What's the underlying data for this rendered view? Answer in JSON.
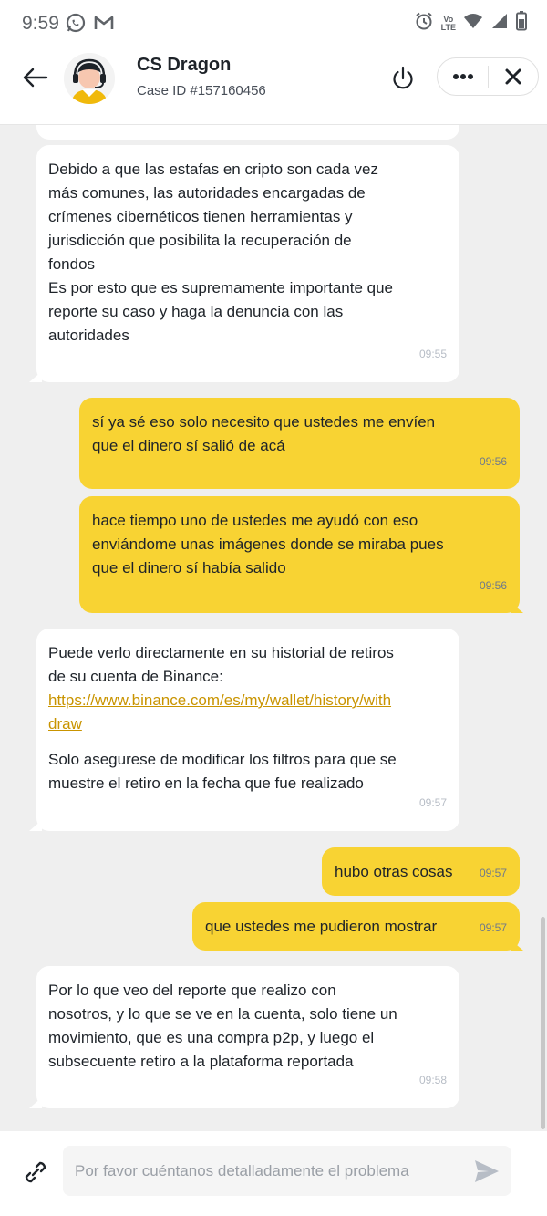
{
  "status_bar": {
    "time": "9:59",
    "lte_top": "Vo",
    "lte_bottom": "LTE"
  },
  "header": {
    "agent_name": "CS Dragon",
    "case_id": "Case ID #157160456"
  },
  "messages": [
    {
      "side": "in",
      "text": "Debido a que las estafas en cripto son cada vez\nmás comunes, las autoridades encargadas de\ncrímenes cibernéticos tienen herramientas y\njurisdicción que posibilita la recuperación de\nfondos\nEs por esto que es supremamente importante que\nreporte su caso y haga la denuncia con las\nautoridades",
      "time": "09:55"
    },
    {
      "side": "out",
      "text": "sí ya sé eso solo necesito que ustedes me envíen\nque el dinero sí salió de acá",
      "time": "09:56"
    },
    {
      "side": "out",
      "text": "hace tiempo uno de ustedes me ayudó con eso\nenviándome unas imágenes donde se miraba pues\nque el dinero sí había salido",
      "time": "09:56"
    },
    {
      "side": "in",
      "text_before_link": "Puede verlo directamente en su historial de retiros\nde su cuenta de Binance:",
      "link": "https://www.binance.com/es/my/wallet/history/with\ndraw",
      "text_after_link": "Solo asegurese de modificar los filtros para que se\nmuestre el retiro en la fecha que fue realizado",
      "time": "09:57"
    },
    {
      "side": "out",
      "text": "hubo otras cosas",
      "time": "09:57"
    },
    {
      "side": "out",
      "text": "que ustedes me pudieron mostrar",
      "time": "09:57"
    },
    {
      "side": "in",
      "text": "Por lo que veo del reporte que realizo con\nnosotros, y lo que se ve en la cuenta, solo tiene un\nmovimiento, que es una compra p2p, y luego el\nsubsecuente retiro a la plataforma reportada",
      "time": "09:58"
    }
  ],
  "input": {
    "placeholder": "Por favor cuéntanos detalladamente el problema"
  },
  "colors": {
    "accent": "#f8d333",
    "incoming_bubble": "#ffffff",
    "chat_background": "#efefef",
    "link": "#c99400"
  },
  "icons": [
    "whatsapp-icon",
    "gmail-icon",
    "alarm-icon",
    "wifi-icon",
    "signal-icon",
    "battery-icon",
    "back-arrow-icon",
    "agent-avatar-icon",
    "power-icon",
    "more-icon",
    "close-icon",
    "attach-link-icon",
    "send-icon"
  ]
}
